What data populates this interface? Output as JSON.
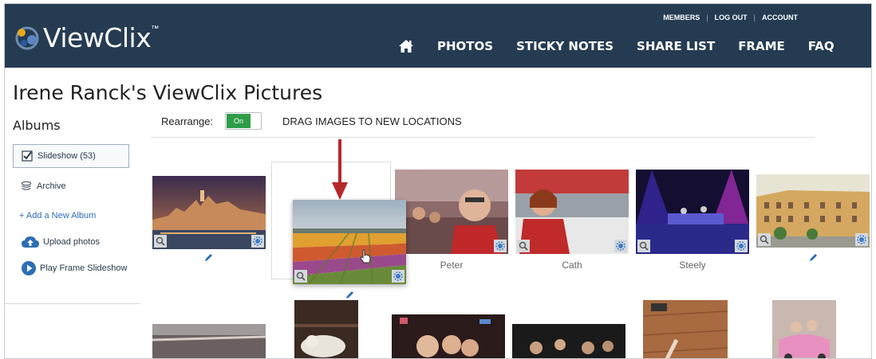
{
  "header": {
    "brand": "ViewClix",
    "brand_mark": "™",
    "utility_links": [
      "MEMBERS",
      "LOG OUT",
      "ACCOUNT"
    ],
    "nav_items": [
      "PHOTOS",
      "STICKY NOTES",
      "SHARE LIST",
      "FRAME",
      "FAQ"
    ],
    "home_icon": "home-icon"
  },
  "page": {
    "title": "Irene Ranck's ViewClix Pictures"
  },
  "sidebar": {
    "heading": "Albums",
    "albums": [
      {
        "label": "Slideshow (53)",
        "icon": "checkbox-checked-icon",
        "active": true
      },
      {
        "label": "Archive",
        "icon": "stack-icon",
        "active": false
      }
    ],
    "add_album": "+ Add a New Album",
    "actions": [
      {
        "label": "Upload photos",
        "icon": "cloud-upload-icon"
      },
      {
        "label": "Play Frame Slideshow",
        "icon": "play-circle-icon"
      }
    ]
  },
  "toolbar": {
    "rearrange_label": "Rearrange:",
    "toggle_state": "On",
    "drag_hint": "DRAG IMAGES TO NEW LOCATIONS"
  },
  "photos": {
    "captions": [
      "Peter",
      "Cath",
      "Steely"
    ]
  },
  "colors": {
    "header_bg": "#253b52",
    "toggle_on": "#2e9d47",
    "link": "#2d6eb5",
    "arrow": "#b5282a",
    "pencil": "#2d6eb5"
  }
}
